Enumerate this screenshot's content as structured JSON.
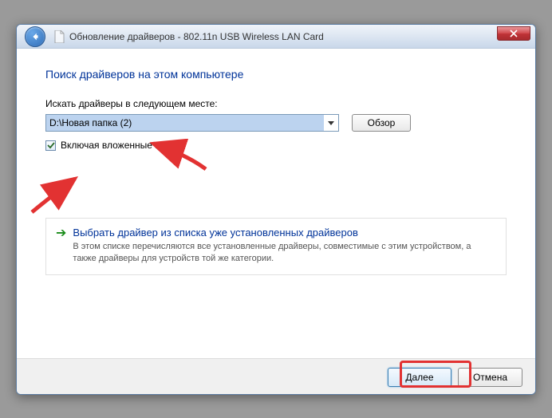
{
  "window": {
    "title": "Обновление драйверов - 802.11n USB Wireless LAN Card"
  },
  "heading": "Поиск драйверов на этом компьютере",
  "search": {
    "label": "Искать драйверы в следующем месте:",
    "path": "D:\\Новая папка (2)",
    "browse": "Обзор"
  },
  "checkbox": {
    "label": "Включая вложенные папки",
    "checked": true
  },
  "option": {
    "title": "Выбрать драйвер из списка уже установленных драйверов",
    "desc": "В этом списке перечисляются все установленные драйверы, совместимые с этим устройством, а также драйверы для устройств той же категории."
  },
  "footer": {
    "next": "Далее",
    "cancel": "Отмена"
  }
}
